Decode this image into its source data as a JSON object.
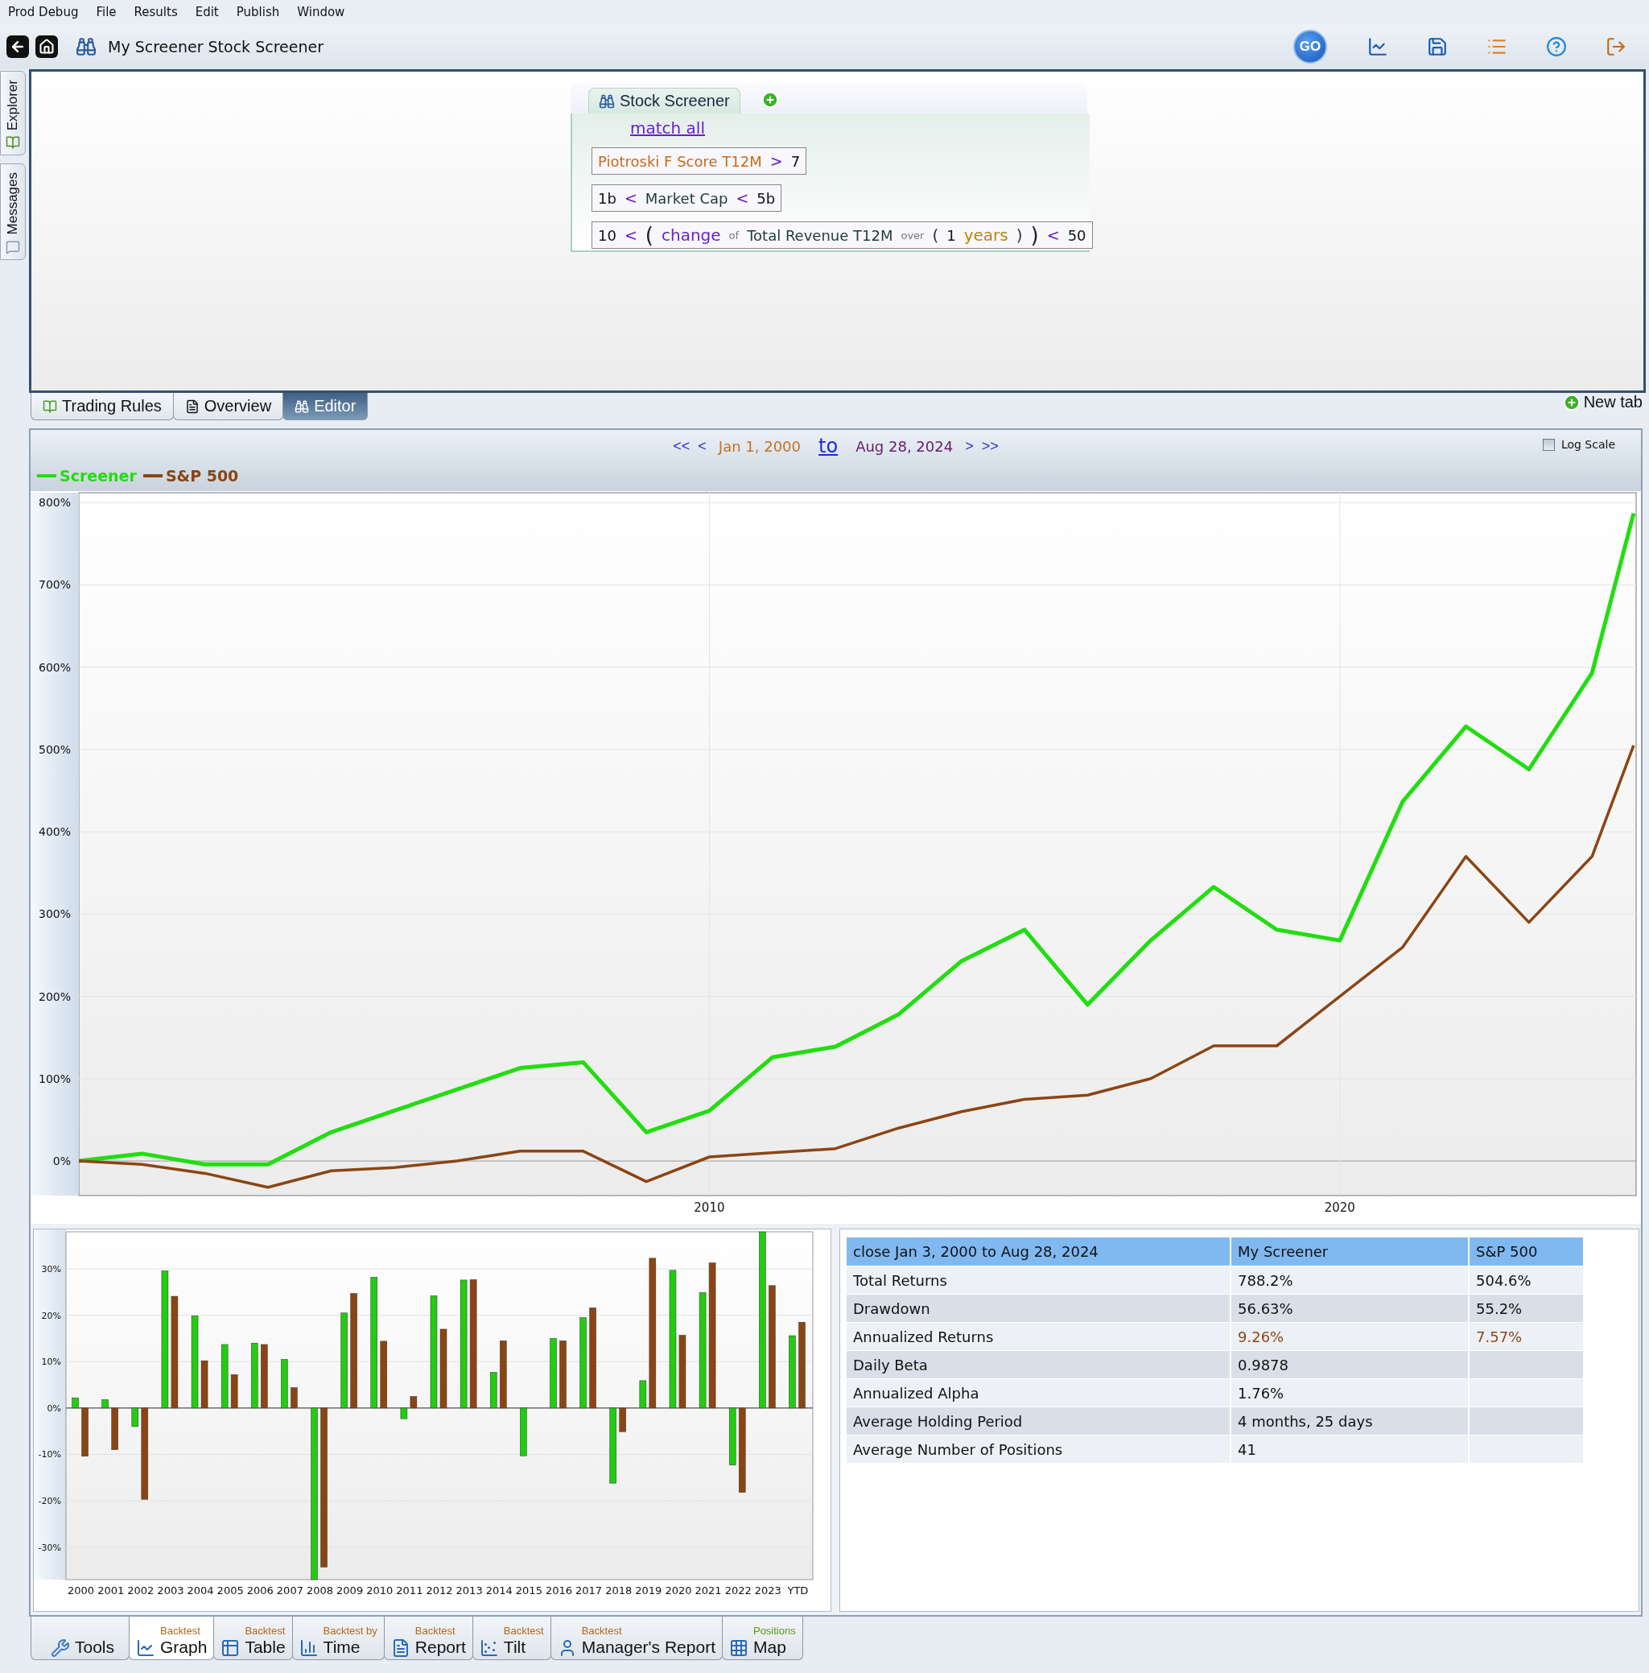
{
  "menu": [
    {
      "label": "Prod Debug"
    },
    {
      "label": "File"
    },
    {
      "label": "Results"
    },
    {
      "label": "Edit"
    },
    {
      "label": "Publish"
    },
    {
      "label": "Window"
    }
  ],
  "toolbar": {
    "title": "My Screener Stock Screener",
    "go": "GO"
  },
  "side_tabs": [
    {
      "label": "Explorer"
    },
    {
      "label": "Messages"
    }
  ],
  "screener": {
    "tab": "Stock Screener",
    "match": "match all",
    "rules": [
      {
        "tokens": [
          {
            "text": "Piotroski F Score T12M",
            "kind": "score"
          },
          {
            "text": ">",
            "kind": "op"
          },
          {
            "text": "7",
            "kind": "value"
          }
        ]
      },
      {
        "tokens": [
          {
            "text": "1b",
            "kind": "value"
          },
          {
            "text": "<",
            "kind": "op"
          },
          {
            "text": "Market Cap",
            "kind": "field"
          },
          {
            "text": "<",
            "kind": "op"
          },
          {
            "text": "5b",
            "kind": "value"
          }
        ]
      },
      {
        "tokens": [
          {
            "text": "10",
            "kind": "value"
          },
          {
            "text": "<",
            "kind": "op"
          },
          {
            "text": "(",
            "kind": "bigparen"
          },
          {
            "text": "change",
            "kind": "func"
          },
          {
            "text": "of",
            "kind": "word"
          },
          {
            "text": "Total Revenue T12M",
            "kind": "field"
          },
          {
            "text": "over",
            "kind": "word"
          },
          {
            "text": "(",
            "kind": "paren"
          },
          {
            "text": "1",
            "kind": "value"
          },
          {
            "text": "years",
            "kind": "unit"
          },
          {
            "text": ")",
            "kind": "paren"
          },
          {
            "text": ")",
            "kind": "bigparen"
          },
          {
            "text": "<",
            "kind": "op"
          },
          {
            "text": "50",
            "kind": "value"
          }
        ]
      }
    ]
  },
  "view_tabs": [
    {
      "label": "Trading Rules",
      "selected": false
    },
    {
      "label": "Overview",
      "selected": false
    },
    {
      "label": "Editor",
      "selected": true
    }
  ],
  "new_tab": "New tab",
  "date_range": {
    "back": [
      "<<",
      "<"
    ],
    "start": "Jan 1, 2000",
    "to": "to",
    "end": "Aug 28, 2024",
    "forward": [
      ">",
      ">>"
    ]
  },
  "log_scale": {
    "label": "Log Scale",
    "checked": false
  },
  "performance": {
    "chart_data": {
      "type": "line",
      "x": [
        2000,
        2001,
        2002,
        2003,
        2004,
        2005,
        2006,
        2007,
        2008,
        2009,
        2010,
        2011,
        2012,
        2013,
        2014,
        2015,
        2016,
        2017,
        2018,
        2019,
        2020,
        2021,
        2022,
        2023,
        2024,
        2024.66
      ],
      "series": [
        {
          "name": "Screener",
          "color": "#22dd11",
          "values": [
            0,
            9,
            -4,
            -4,
            35,
            61,
            87,
            113,
            120,
            35,
            61,
            126,
            139,
            178,
            243,
            281,
            190,
            268,
            333,
            281,
            268,
            437,
            528,
            476,
            593,
            787
          ]
        },
        {
          "name": "S&P 500",
          "color": "#8b4513",
          "values": [
            0,
            -4,
            -15,
            -32,
            -12,
            -8,
            0,
            12,
            12,
            -25,
            5,
            10,
            15,
            40,
            60,
            75,
            80,
            100,
            140,
            140,
            200,
            260,
            370,
            290,
            370,
            505
          ]
        }
      ],
      "xlim": [
        2000,
        2024.7
      ],
      "ylim": [
        -42,
        812
      ],
      "xticks": [
        2010,
        2020
      ],
      "grid": true,
      "yticks": [
        {
          "value": 0,
          "label": "0%"
        },
        {
          "value": 100,
          "label": "100%"
        },
        {
          "value": 200,
          "label": "200%"
        },
        {
          "value": 300,
          "label": "300%"
        },
        {
          "value": 400,
          "label": "400%"
        },
        {
          "value": 500,
          "label": "500%"
        },
        {
          "value": 600,
          "label": "600%"
        },
        {
          "value": 700,
          "label": "700%"
        },
        {
          "value": 800,
          "label": "800%"
        }
      ]
    }
  },
  "annual_returns": {
    "chart_data": {
      "type": "bar",
      "categories": [
        "2000",
        "2001",
        "2002",
        "2003",
        "2004",
        "2005",
        "2006",
        "2007",
        "2008",
        "2009",
        "2010",
        "2011",
        "2012",
        "2013",
        "2014",
        "2015",
        "2016",
        "2017",
        "2018",
        "2019",
        "2020",
        "2021",
        "2022",
        "2023",
        "YTD"
      ],
      "series": [
        {
          "color": "#22cc11",
          "values": [
            2.2,
            1.8,
            -4,
            29.6,
            19.9,
            13.7,
            14,
            10.5,
            -37,
            20.5,
            28.2,
            -2.3,
            24.2,
            27.6,
            7.7,
            -10.3,
            15,
            19.5,
            -16.2,
            5.9,
            29.7,
            24.9,
            -12.3,
            38,
            15.6
          ]
        },
        {
          "color": "#8b4513",
          "values": [
            -10.4,
            -9,
            -19.7,
            24.1,
            10.2,
            7.2,
            13.7,
            4.4,
            -34.3,
            24.7,
            14.4,
            2.5,
            17,
            27.7,
            14.5,
            0,
            14.5,
            21.6,
            -5.1,
            32.3,
            15.7,
            31.3,
            -18.2,
            26.4,
            18.5
          ]
        }
      ],
      "ylim": [
        -37,
        38
      ],
      "grid": true,
      "yticks": [
        {
          "value": -30,
          "label": "-30%"
        },
        {
          "value": -20,
          "label": "-20%"
        },
        {
          "value": -10,
          "label": "-10%"
        },
        {
          "value": 0,
          "label": "0%"
        },
        {
          "value": 10,
          "label": "10%"
        },
        {
          "value": 20,
          "label": "20%"
        },
        {
          "value": 30,
          "label": "30%"
        }
      ]
    }
  },
  "stats_table": {
    "columns": [
      "close Jan 3, 2000 to Aug 28, 2024",
      "My Screener",
      "S&P 500"
    ],
    "rows": [
      {
        "kind": "plain",
        "cells": [
          "Total Returns",
          "788.2%",
          "504.6%"
        ]
      },
      {
        "kind": "plain",
        "cells": [
          "Drawdown",
          "56.63%",
          "55.2%"
        ]
      },
      {
        "kind": "highlight",
        "cells": [
          "Annualized Returns",
          "9.26%",
          "7.57%"
        ]
      },
      {
        "kind": "plain",
        "cells": [
          "Daily Beta",
          "0.9878"
        ]
      },
      {
        "kind": "plain",
        "cells": [
          "Annualized Alpha",
          "1.76%"
        ]
      },
      {
        "kind": "plain",
        "cells": [
          "Average Holding Period",
          "4 months, 25 days"
        ]
      },
      {
        "kind": "plain",
        "cells": [
          "Average Number of Positions",
          "41"
        ]
      }
    ]
  },
  "bottom_tabs": [
    {
      "label": "Tools",
      "selected": false
    },
    {
      "caption": "Backtest",
      "color": "#b8651a",
      "label": "Graph",
      "selected": true
    },
    {
      "caption": "Backtest",
      "color": "#b8651a",
      "label": "Table",
      "selected": false
    },
    {
      "caption": "Backtest by",
      "color": "#b8651a",
      "label": "Time",
      "selected": false
    },
    {
      "caption": "Backtest",
      "color": "#b8651a",
      "label": "Report",
      "selected": false
    },
    {
      "caption": "Backtest",
      "color": "#b8651a",
      "label": "Tilt",
      "selected": false
    },
    {
      "caption": "Backtest",
      "color": "#b8651a",
      "label": "Manager's Report",
      "selected": false
    },
    {
      "caption": "Positions",
      "color": "#5a9a1a",
      "label": "Map",
      "selected": false
    }
  ]
}
